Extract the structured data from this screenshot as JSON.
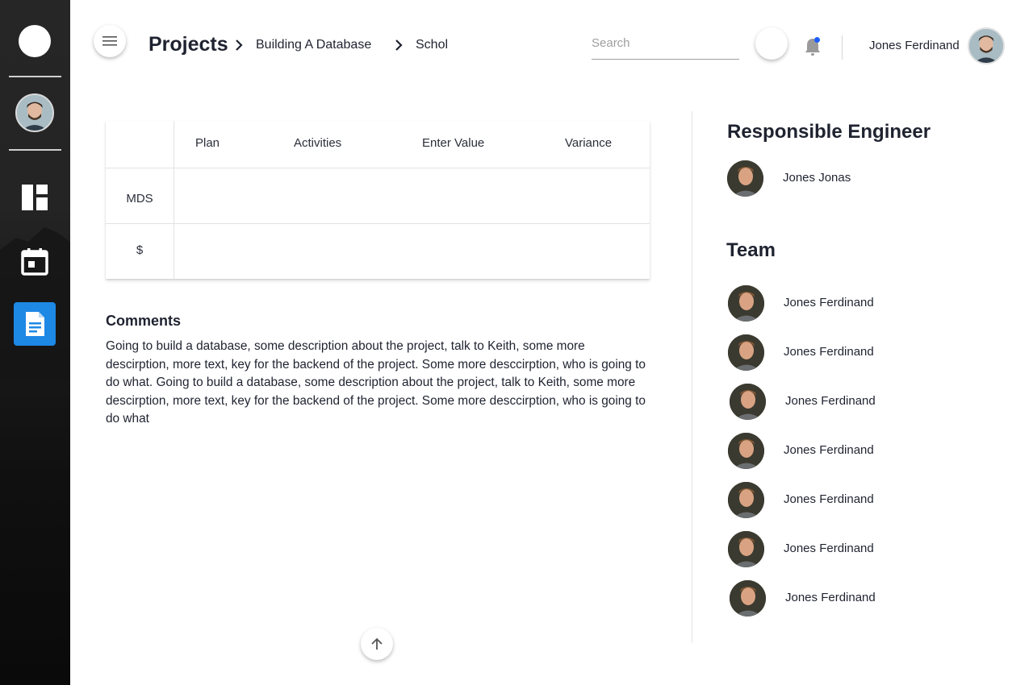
{
  "header": {
    "breadcrumb": {
      "title": "Projects",
      "items": [
        "Building A Database",
        "Schol"
      ]
    },
    "search": {
      "placeholder": "Search",
      "value": ""
    },
    "user": {
      "name": "Jones Ferdinand"
    }
  },
  "table": {
    "columns": [
      "Plan",
      "Activities",
      "Enter Value",
      "Variance"
    ],
    "rows": [
      {
        "label": "MDS",
        "cells": [
          "",
          "",
          "",
          ""
        ]
      },
      {
        "label": "$",
        "cells": [
          "",
          "",
          "",
          ""
        ]
      }
    ]
  },
  "comments": {
    "title": "Comments",
    "body": "Going to build a database, some description about the project, talk to Keith, some more descirption, more text, key for the backend of the project. Some more desccirption, who is going to do what. Going to build a database, some description about the project, talk to Keith, some more descirption, more text, key for the backend of the project. Some more desccirption, who is going to do what"
  },
  "responsible": {
    "title": "Responsible Engineer",
    "name": "Jones Jonas"
  },
  "team": {
    "title": "Team",
    "members": [
      "Jones Ferdinand",
      "Jones Ferdinand",
      "Jones Ferdinand",
      "Jones Ferdinand",
      "Jones Ferdinand",
      "Jones Ferdinand",
      "Jones Ferdinand"
    ]
  },
  "icons": {
    "sidebar": [
      "logo-icon",
      "user-avatar",
      "dashboard-icon",
      "calendar-icon",
      "document-icon"
    ],
    "header": [
      "menu-icon",
      "chevron-right-icon",
      "bell-icon"
    ],
    "footer": [
      "arrow-up-icon"
    ]
  },
  "colors": {
    "accent": "#1e88e5",
    "notification_dot": "#1e5eff",
    "sidebar_bg": "#1b1b1b",
    "text": "#1f2330"
  }
}
